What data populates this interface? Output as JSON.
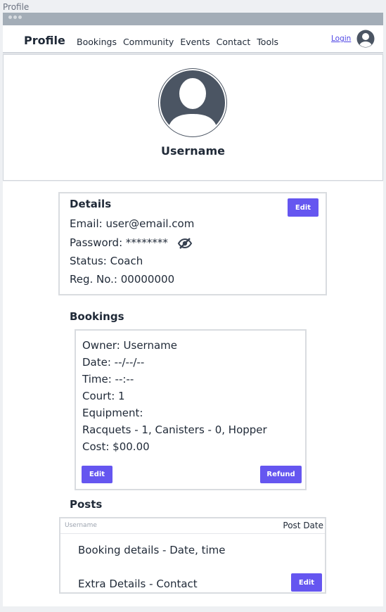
{
  "window": {
    "tab_title": "Profile"
  },
  "navbar": {
    "brand": "Profile",
    "links": [
      "Bookings",
      "Community",
      "Events",
      "Contact",
      "Tools"
    ],
    "login_label": "Login"
  },
  "profile": {
    "username": "Username"
  },
  "details": {
    "title": "Details",
    "edit_label": "Edit",
    "email": "Email: user@email.com",
    "password": "Password: ********",
    "status": "Status: Coach",
    "reg_no": "Reg. No.: 00000000"
  },
  "bookings": {
    "title": "Bookings",
    "owner": "Owner: Username",
    "date": "Date: --/--/--",
    "time": "Time: --:--",
    "court": "Court: 1",
    "equipment_label": "Equipment:",
    "equipment_items": "Racquets - 1, Canisters - 0, Hopper",
    "cost": "Cost: $00.00",
    "edit_label": "Edit",
    "refund_label": "Refund"
  },
  "posts": {
    "title": "Posts",
    "header_username": "Username",
    "header_date": "Post Date",
    "line1": "Booking details - Date, time",
    "line2": "Extra Details - Contact",
    "edit_label": "Edit"
  },
  "colors": {
    "accent": "#6556f0",
    "avatar": "#4b5563",
    "link": "#4f46e5"
  },
  "icons": {
    "nav_avatar": "user-avatar-icon",
    "profile_avatar": "user-avatar-icon",
    "password_toggle": "eye-slash-icon"
  }
}
